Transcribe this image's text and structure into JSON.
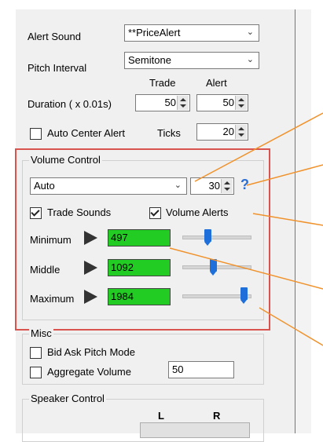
{
  "alert_sound": {
    "label": "Alert Sound",
    "value": "**PriceAlert"
  },
  "pitch_interval": {
    "label": "Pitch Interval",
    "value": "Semitone"
  },
  "duration": {
    "col_trade": "Trade",
    "col_alert": "Alert",
    "label": "Duration ( x 0.01s)",
    "trade_value": "50",
    "alert_value": "50"
  },
  "auto_center": {
    "label": "Auto Center Alert",
    "checked": false,
    "ticks_label": "Ticks",
    "ticks_value": "20"
  },
  "volume_control": {
    "title": "Volume Control",
    "mode_value": "Auto",
    "spin_value": "30",
    "help_glyph": "?",
    "trade_sounds_label": "Trade Sounds",
    "trade_sounds_checked": true,
    "volume_alerts_label": "Volume Alerts",
    "volume_alerts_checked": true,
    "rows": [
      {
        "label": "Minimum",
        "value": "497"
      },
      {
        "label": "Middle",
        "value": "1092"
      },
      {
        "label": "Maximum",
        "value": "1984"
      }
    ],
    "slider_levels": [
      0.37,
      0.45,
      0.96
    ]
  },
  "misc": {
    "title": "Misc",
    "bid_ask_label": "Bid Ask Pitch Mode",
    "aggregate_label": "Aggregate Volume",
    "aggregate_value": "50"
  },
  "speaker": {
    "title": "Speaker Control",
    "col_l": "L",
    "col_r": "R"
  },
  "colors": {
    "highlight": "#d9534f",
    "pointer": "#f0922b",
    "value_bg": "#22cc22",
    "slider": "#1e6fd9"
  }
}
